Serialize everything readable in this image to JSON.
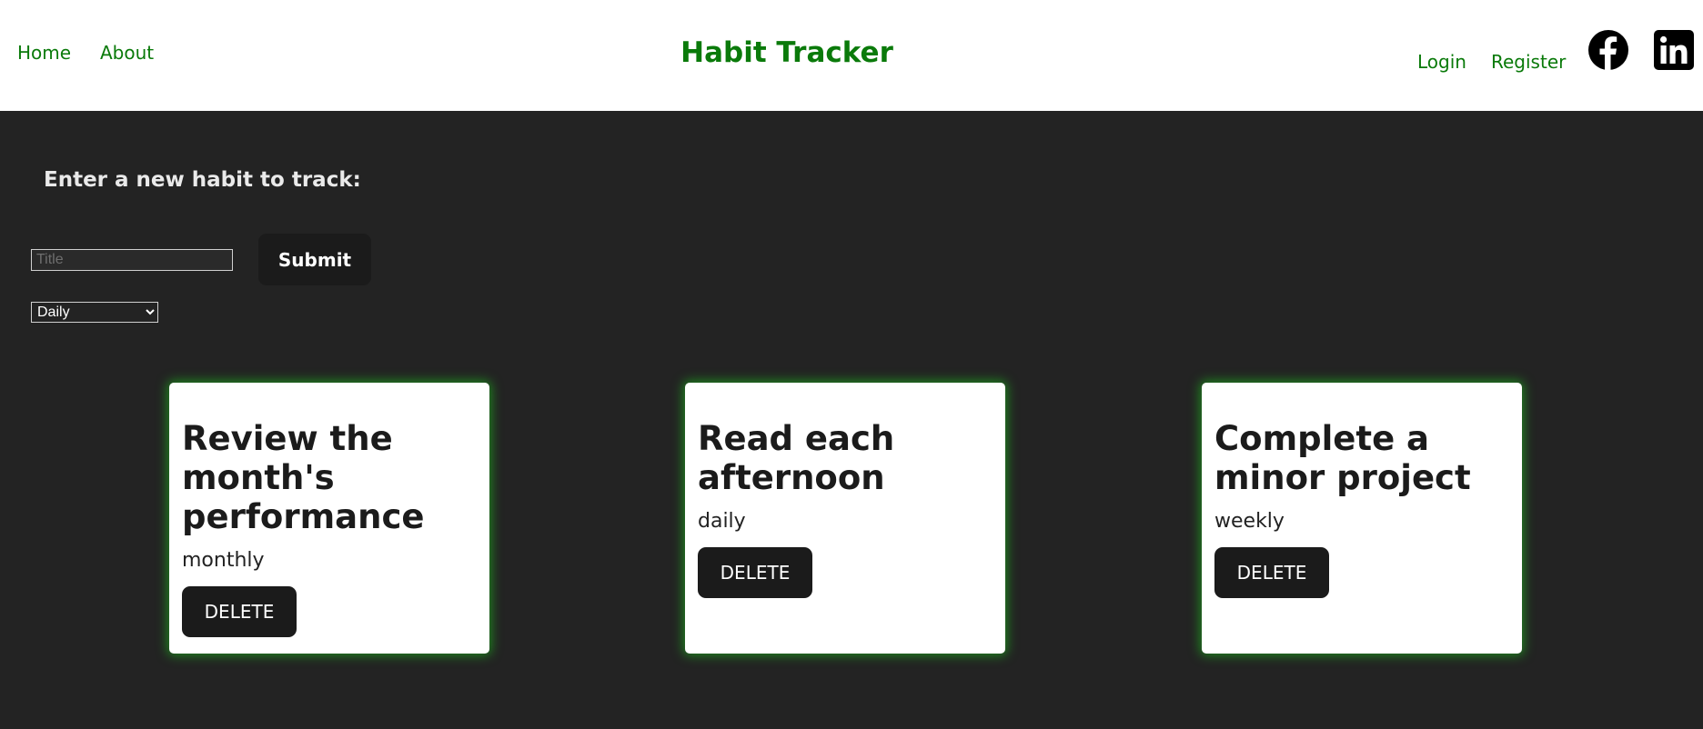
{
  "header": {
    "nav_left": [
      {
        "label": "Home"
      },
      {
        "label": "About"
      }
    ],
    "site_title": "Habit Tracker",
    "nav_right": [
      {
        "label": "Login"
      },
      {
        "label": "Register"
      }
    ],
    "social_icons": [
      "facebook-icon",
      "linkedin-icon"
    ]
  },
  "form": {
    "heading": "Enter a new habit to track:",
    "title_input": {
      "value": "",
      "placeholder": "Title"
    },
    "submit_label": "Submit",
    "frequency_select": {
      "selected": "Daily"
    }
  },
  "habits": [
    {
      "title": "Review the month's performance",
      "frequency": "monthly",
      "delete_label": "DELETE"
    },
    {
      "title": "Read each afternoon",
      "frequency": "daily",
      "delete_label": "DELETE"
    },
    {
      "title": "Complete a minor project",
      "frequency": "weekly",
      "delete_label": "DELETE"
    }
  ],
  "colors": {
    "accent": "#0a7a0a",
    "background": "#232323",
    "card_glow": "#1f8a1f",
    "button": "#1b1b1b"
  }
}
